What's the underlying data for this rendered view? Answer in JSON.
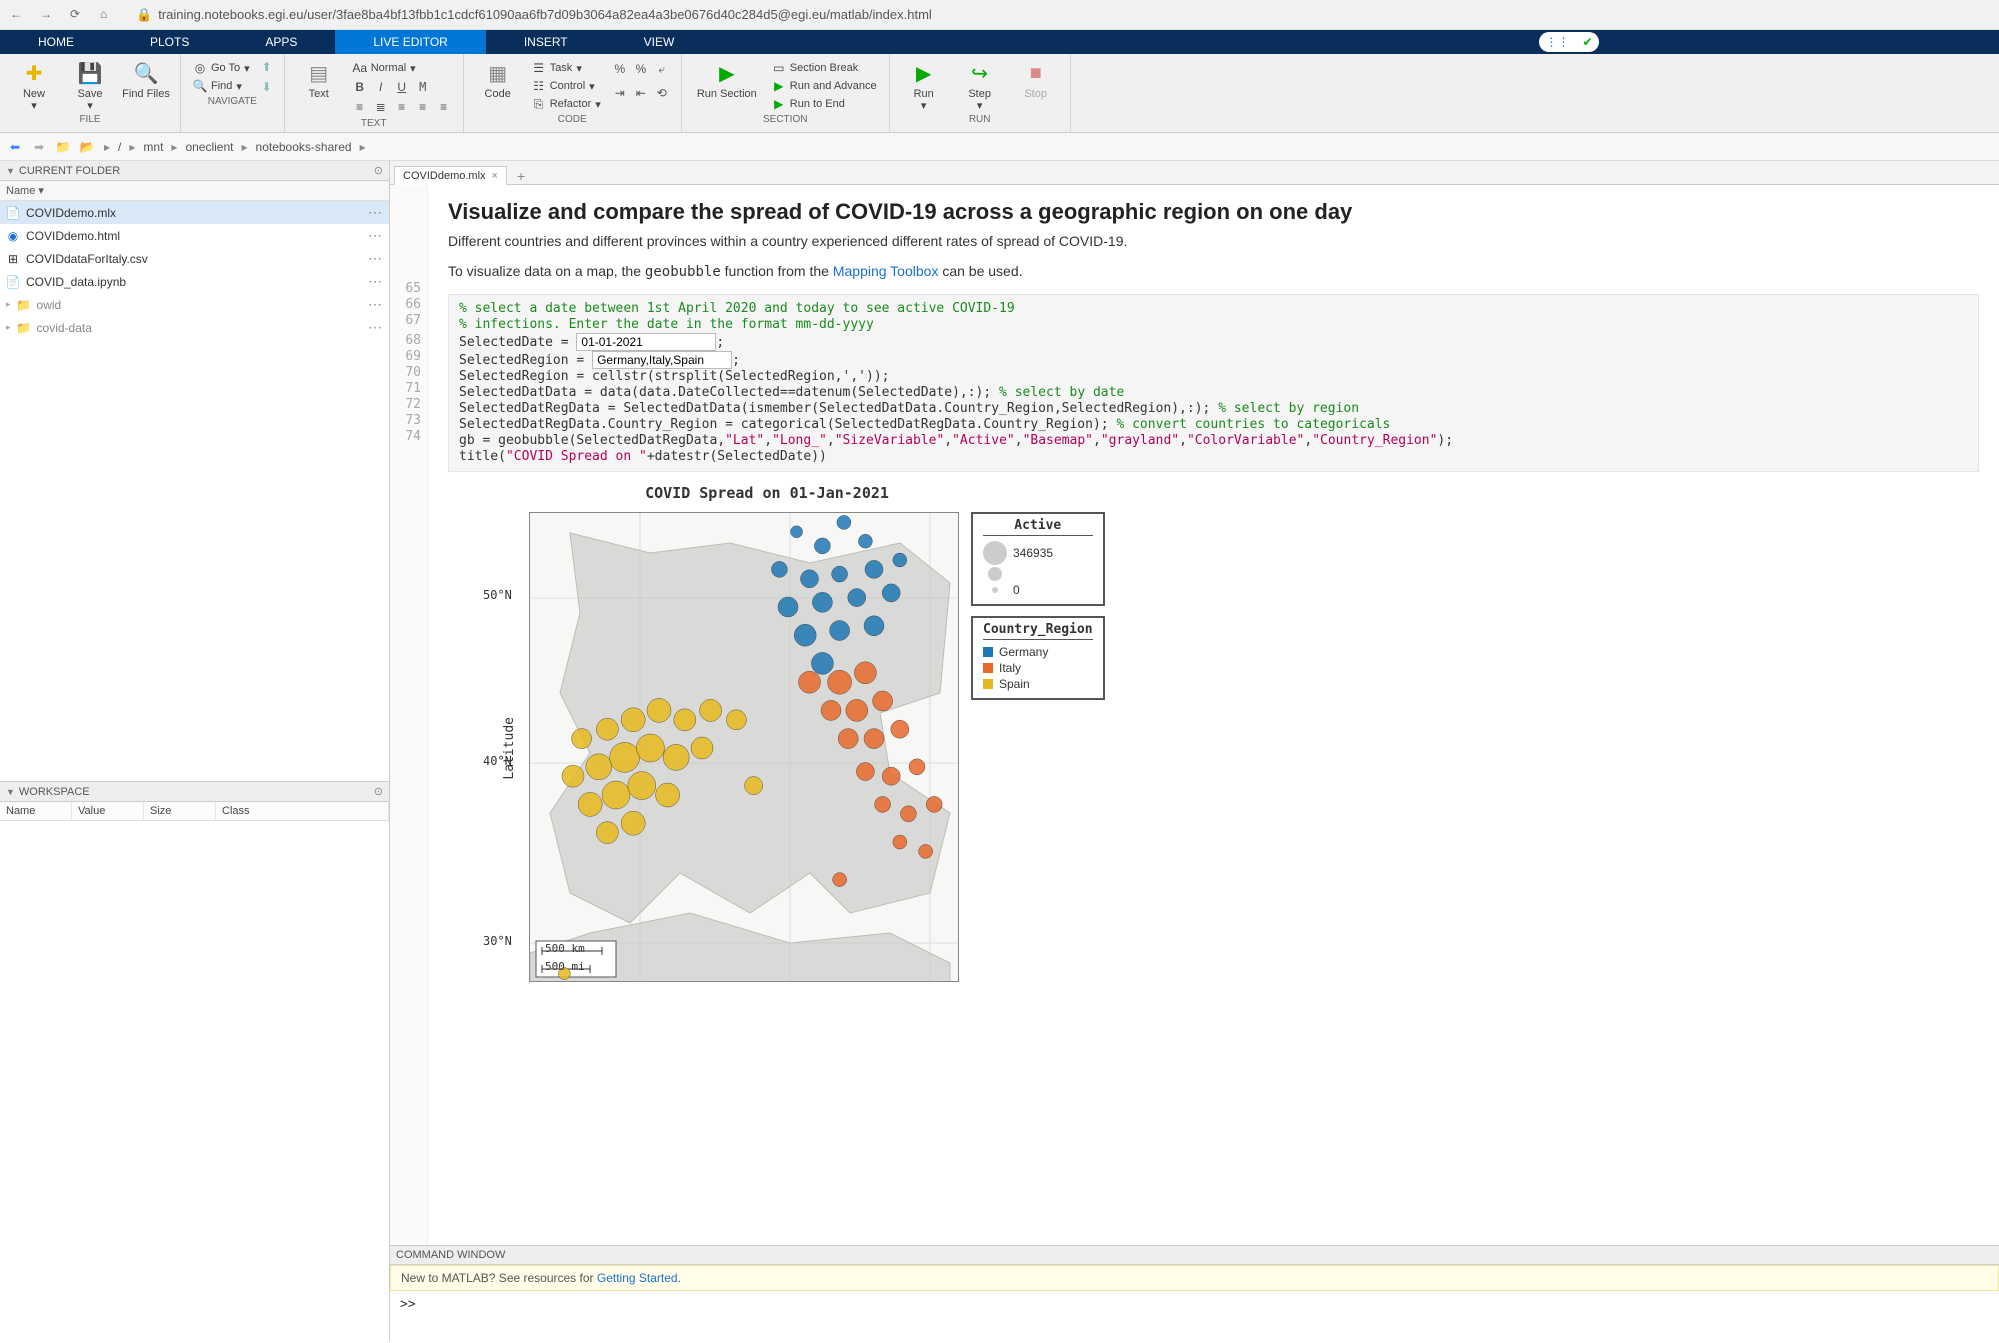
{
  "browser": {
    "url": "training.notebooks.egi.eu/user/3fae8ba4bf13fbb1c1cdcf61090aa6fb7d09b3064a82ea4a3be0676d40c284d5@egi.eu/matlab/index.html"
  },
  "tabs": {
    "items": [
      "HOME",
      "PLOTS",
      "APPS",
      "LIVE EDITOR",
      "INSERT",
      "VIEW"
    ],
    "active": "LIVE EDITOR"
  },
  "toolstrip": {
    "file": {
      "title": "FILE",
      "new": "New",
      "save": "Save",
      "findfiles": "Find Files"
    },
    "navigate": {
      "title": "NAVIGATE",
      "goto": "Go To",
      "find": "Find"
    },
    "text": {
      "title": "TEXT",
      "label": "Text",
      "normal": "Normal"
    },
    "code": {
      "title": "CODE",
      "label": "Code",
      "task": "Task",
      "control": "Control",
      "refactor": "Refactor"
    },
    "section": {
      "title": "SECTION",
      "runsection": "Run Section",
      "sectionbreak": "Section Break",
      "runadvance": "Run and Advance",
      "runtoend": "Run to End"
    },
    "run": {
      "title": "RUN",
      "run": "Run",
      "step": "Step",
      "stop": "Stop"
    }
  },
  "breadcrumb": {
    "items": [
      "/",
      "mnt",
      "oneclient",
      "notebooks-shared"
    ]
  },
  "currentFolder": {
    "title": "CURRENT FOLDER",
    "header": "Name",
    "items": [
      {
        "name": "COVIDdemo.mlx",
        "icon": "mlx",
        "selected": true
      },
      {
        "name": "COVIDdemo.html",
        "icon": "html",
        "selected": false
      },
      {
        "name": "COVIDdataForItaly.csv",
        "icon": "csv",
        "selected": false
      },
      {
        "name": "COVID_data.ipynb",
        "icon": "ipynb",
        "selected": false
      },
      {
        "name": "owid",
        "icon": "folder",
        "selected": false
      },
      {
        "name": "covid-data",
        "icon": "folder",
        "selected": false
      }
    ]
  },
  "workspace": {
    "title": "WORKSPACE",
    "cols": [
      "Name",
      "Value",
      "Size",
      "Class"
    ]
  },
  "editor": {
    "tab": "COVIDdemo.mlx",
    "title": "Visualize and compare the spread of COVID-19 across a geographic region on one day",
    "p1": "Different countries and different provinces within a country experienced different rates of spread of COVID-19.",
    "p2_pre": "To visualize data on a map, the ",
    "p2_code": "geobubble",
    "p2_mid": " function from the ",
    "p2_link": "Mapping Toolbox",
    "p2_post": " can be used.",
    "lines": [
      "65",
      "66",
      "67",
      "68",
      "69",
      "70",
      "71",
      "72",
      "73",
      "74"
    ],
    "code": {
      "c1": "% select a date between 1st April 2020 and today to see active COVID-19",
      "c2": "% infections. Enter the date in the format mm-dd-yyyy",
      "l67a": "SelectedDate = ",
      "l67b": ";",
      "input_date": "01-01-2021",
      "l68a": "SelectedRegion = ",
      "l68b": ";",
      "input_region": "Germany,Italy,Spain",
      "l69": "SelectedRegion = cellstr(strsplit(SelectedRegion,','));",
      "l70a": "SelectedDatData = data(data.DateCollected==datenum(SelectedDate),:); ",
      "l70b": "% select by date",
      "l71a": "SelectedDatRegData = SelectedDatData(ismember(SelectedDatData.Country_Region,SelectedRegion),:); ",
      "l71b": "% select by region",
      "l72a": "SelectedDatRegData.Country_Region = categorical(SelectedDatRegData.Country_Region); ",
      "l72b": "% convert countries to categoricals",
      "l73a": "gb = geobubble(SelectedDatRegData,",
      "s_lat": "\"Lat\"",
      "s_long": "\"Long_\"",
      "s_size": "\"SizeVariable\"",
      "s_active": "\"Active\"",
      "s_base": "\"Basemap\"",
      "s_gray": "\"grayland\"",
      "s_color": "\"ColorVariable\"",
      "s_cr": "\"Country_Region\"",
      "l73b": ");",
      "l74a": "title(",
      "s_title": "\"COVID Spread on \"",
      "l74b": "+datestr(SelectedDate))"
    }
  },
  "chart_data": {
    "type": "bubble_map",
    "title": "COVID Spread on 01-Jan-2021",
    "ylabel": "Latitude",
    "lat_ticks": [
      "50°N",
      "40°N",
      "30°N"
    ],
    "scale_labels": [
      "500 km",
      "500 mi"
    ],
    "legends": {
      "size": {
        "title": "Active",
        "max": "346935",
        "min": "0"
      },
      "color": {
        "title": "Country_Region",
        "items": [
          {
            "name": "Germany",
            "color": "#1f77b4"
          },
          {
            "name": "Italy",
            "color": "#e8682c"
          },
          {
            "name": "Spain",
            "color": "#e6b81f"
          }
        ]
      }
    },
    "bubbles_germany": [
      {
        "x": 0.62,
        "y": 0.04,
        "r": 6
      },
      {
        "x": 0.68,
        "y": 0.07,
        "r": 8
      },
      {
        "x": 0.73,
        "y": 0.02,
        "r": 7
      },
      {
        "x": 0.78,
        "y": 0.06,
        "r": 7
      },
      {
        "x": 0.58,
        "y": 0.12,
        "r": 8
      },
      {
        "x": 0.65,
        "y": 0.14,
        "r": 9
      },
      {
        "x": 0.72,
        "y": 0.13,
        "r": 8
      },
      {
        "x": 0.8,
        "y": 0.12,
        "r": 9
      },
      {
        "x": 0.86,
        "y": 0.1,
        "r": 7
      },
      {
        "x": 0.6,
        "y": 0.2,
        "r": 10
      },
      {
        "x": 0.68,
        "y": 0.19,
        "r": 10
      },
      {
        "x": 0.76,
        "y": 0.18,
        "r": 9
      },
      {
        "x": 0.84,
        "y": 0.17,
        "r": 9
      },
      {
        "x": 0.64,
        "y": 0.26,
        "r": 11
      },
      {
        "x": 0.72,
        "y": 0.25,
        "r": 10
      },
      {
        "x": 0.8,
        "y": 0.24,
        "r": 10
      },
      {
        "x": 0.68,
        "y": 0.32,
        "r": 11
      }
    ],
    "bubbles_italy": [
      {
        "x": 0.65,
        "y": 0.36,
        "r": 11
      },
      {
        "x": 0.72,
        "y": 0.36,
        "r": 12
      },
      {
        "x": 0.78,
        "y": 0.34,
        "r": 11
      },
      {
        "x": 0.7,
        "y": 0.42,
        "r": 10
      },
      {
        "x": 0.76,
        "y": 0.42,
        "r": 11
      },
      {
        "x": 0.82,
        "y": 0.4,
        "r": 10
      },
      {
        "x": 0.74,
        "y": 0.48,
        "r": 10
      },
      {
        "x": 0.8,
        "y": 0.48,
        "r": 10
      },
      {
        "x": 0.86,
        "y": 0.46,
        "r": 9
      },
      {
        "x": 0.78,
        "y": 0.55,
        "r": 9
      },
      {
        "x": 0.84,
        "y": 0.56,
        "r": 9
      },
      {
        "x": 0.9,
        "y": 0.54,
        "r": 8
      },
      {
        "x": 0.82,
        "y": 0.62,
        "r": 8
      },
      {
        "x": 0.88,
        "y": 0.64,
        "r": 8
      },
      {
        "x": 0.94,
        "y": 0.62,
        "r": 8
      },
      {
        "x": 0.86,
        "y": 0.7,
        "r": 7
      },
      {
        "x": 0.92,
        "y": 0.72,
        "r": 7
      },
      {
        "x": 0.72,
        "y": 0.78,
        "r": 7
      }
    ],
    "bubbles_spain": [
      {
        "x": 0.12,
        "y": 0.48,
        "r": 10
      },
      {
        "x": 0.18,
        "y": 0.46,
        "r": 11
      },
      {
        "x": 0.24,
        "y": 0.44,
        "r": 12
      },
      {
        "x": 0.3,
        "y": 0.42,
        "r": 12
      },
      {
        "x": 0.36,
        "y": 0.44,
        "r": 11
      },
      {
        "x": 0.42,
        "y": 0.42,
        "r": 11
      },
      {
        "x": 0.48,
        "y": 0.44,
        "r": 10
      },
      {
        "x": 0.1,
        "y": 0.56,
        "r": 11
      },
      {
        "x": 0.16,
        "y": 0.54,
        "r": 13
      },
      {
        "x": 0.22,
        "y": 0.52,
        "r": 15
      },
      {
        "x": 0.28,
        "y": 0.5,
        "r": 14
      },
      {
        "x": 0.34,
        "y": 0.52,
        "r": 13
      },
      {
        "x": 0.4,
        "y": 0.5,
        "r": 11
      },
      {
        "x": 0.14,
        "y": 0.62,
        "r": 12
      },
      {
        "x": 0.2,
        "y": 0.6,
        "r": 14
      },
      {
        "x": 0.26,
        "y": 0.58,
        "r": 14
      },
      {
        "x": 0.32,
        "y": 0.6,
        "r": 12
      },
      {
        "x": 0.18,
        "y": 0.68,
        "r": 11
      },
      {
        "x": 0.24,
        "y": 0.66,
        "r": 12
      },
      {
        "x": 0.52,
        "y": 0.58,
        "r": 9
      },
      {
        "x": 0.08,
        "y": 0.98,
        "r": 6
      }
    ]
  },
  "commandWindow": {
    "title": "COMMAND WINDOW",
    "banner_pre": "New to MATLAB? See resources for ",
    "banner_link": "Getting Started",
    "banner_post": ".",
    "prompt": ">>"
  }
}
